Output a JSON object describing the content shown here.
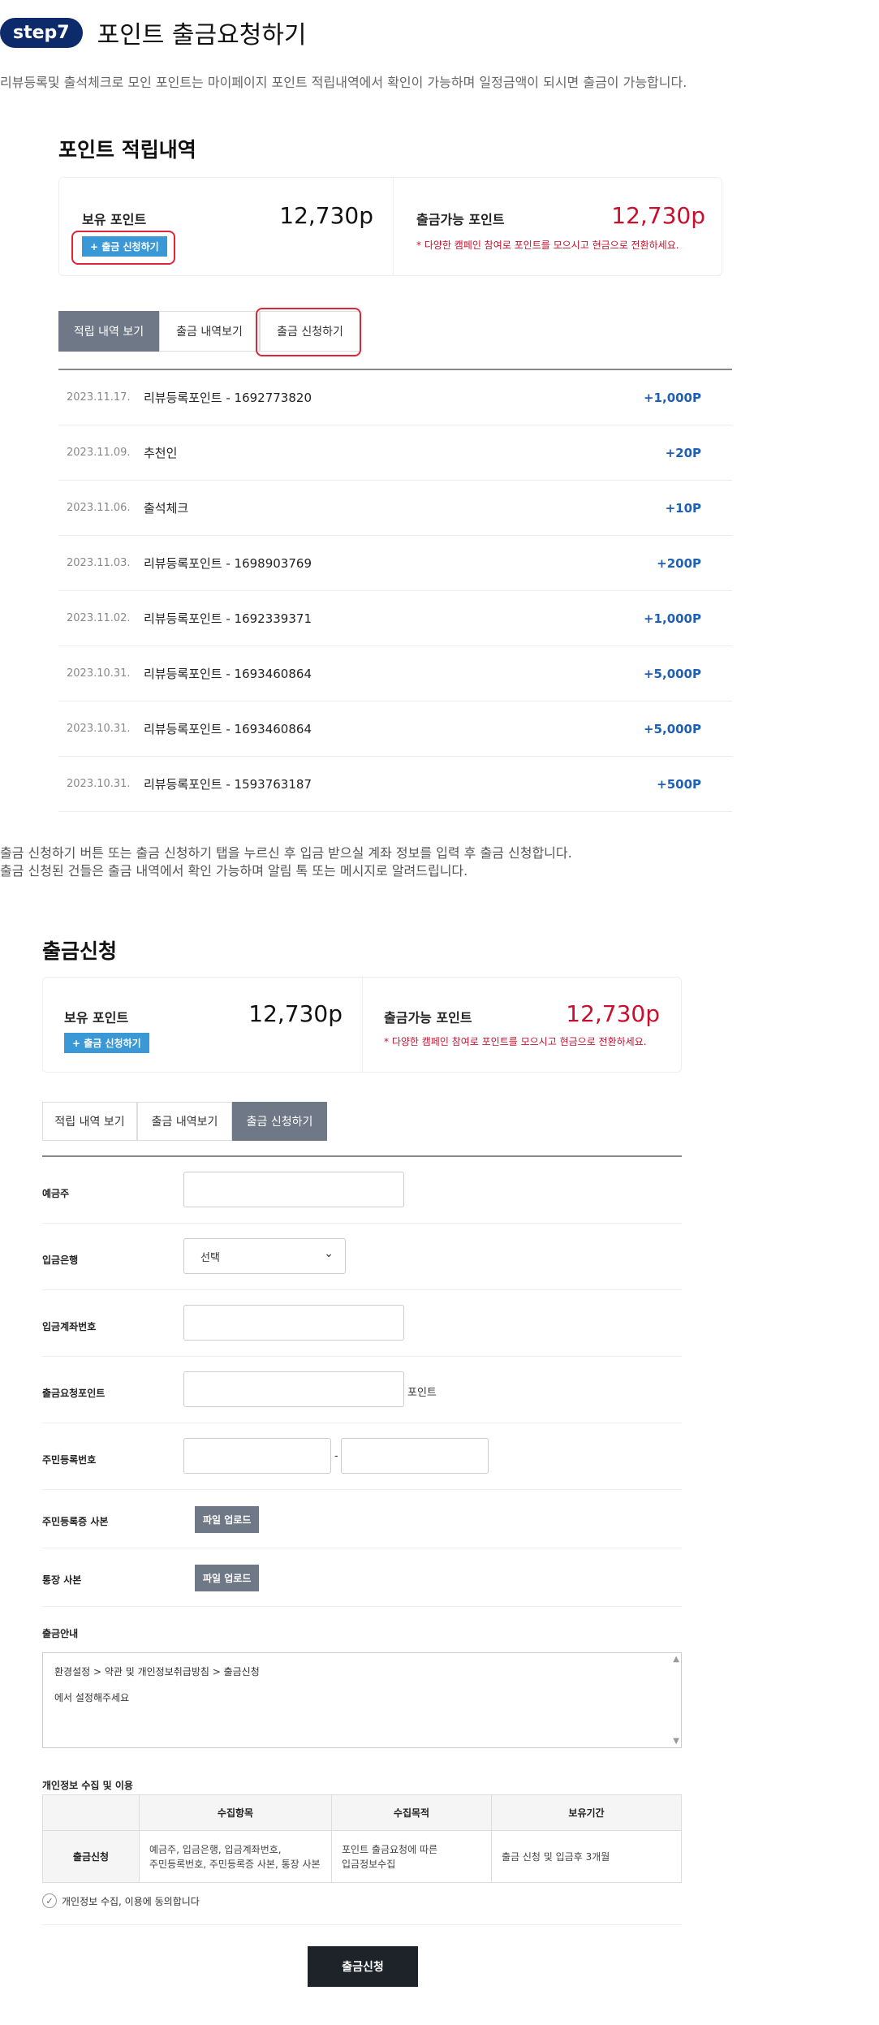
{
  "step": {
    "badge": "step7",
    "title": "포인트 출금요청하기"
  },
  "intro": "리뷰등록및 출석체크로 모인 포인트는 마이페이지 포인트 적립내역에서 확인이 가능하며 일정금액이 되시면 출금이 가능합니다.",
  "history": {
    "title": "포인트 적립내역",
    "card": {
      "held_label": "보유 포인트",
      "held_value": "12,730p",
      "request_button": "+ 출금 신청하기",
      "available_label": "출금가능 포인트",
      "available_value": "12,730p",
      "note": "* 다양한 캠페인 참여로 포인트를 모으시고 현금으로 전환하세요."
    },
    "tabs": [
      {
        "label": "적립 내역 보기"
      },
      {
        "label": "출금 내역보기"
      },
      {
        "label": "출금 신청하기"
      }
    ],
    "rows": [
      {
        "date": "2023.11.17.",
        "desc": "리뷰등록포인트 - 1692773820",
        "amount": "+1,000P"
      },
      {
        "date": "2023.11.09.",
        "desc": "추천인",
        "amount": "+20P"
      },
      {
        "date": "2023.11.06.",
        "desc": "출석체크",
        "amount": "+10P"
      },
      {
        "date": "2023.11.03.",
        "desc": "리뷰등록포인트 - 1698903769",
        "amount": "+200P"
      },
      {
        "date": "2023.11.02.",
        "desc": "리뷰등록포인트 - 1692339371",
        "amount": "+1,000P"
      },
      {
        "date": "2023.10.31.",
        "desc": "리뷰등록포인트 - 1693460864",
        "amount": "+5,000P"
      },
      {
        "date": "2023.10.31.",
        "desc": "리뷰등록포인트 - 1693460864",
        "amount": "+5,000P"
      },
      {
        "date": "2023.10.31.",
        "desc": "리뷰등록포인트 - 1593763187",
        "amount": "+500P"
      }
    ]
  },
  "note2": {
    "line1": "출금 신청하기 버튼 또는 출금 신청하기 탭을 누르신 후 입금 받으실 계좌 정보를 입력 후 출금 신청합니다.",
    "line2": "출금 신청된 건들은 출금 내역에서 확인 가능하며 알림 톡 또는 메시지로 알려드립니다."
  },
  "withdraw": {
    "title": "출금신청",
    "card": {
      "held_label": "보유 포인트",
      "held_value": "12,730p",
      "request_button": "+ 출금 신청하기",
      "available_label": "출금가능 포인트",
      "available_value": "12,730p",
      "note": "* 다양한 캠페인 참여로 포인트를 모으시고 현금으로 전환하세요."
    },
    "tabs": [
      {
        "label": "적립 내역 보기"
      },
      {
        "label": "출금 내역보기"
      },
      {
        "label": "출금 신청하기"
      }
    ],
    "form": {
      "depositor": "예금주",
      "bank": "입금은행",
      "bank_selected": "선택",
      "account": "입금계좌번호",
      "request_points": "출금요청포인트",
      "points_suffix": "포인트",
      "rrn": "주민등록번호",
      "rrn_dash": "-",
      "rrn_copy": "주민등록증 사본",
      "bankbook_copy": "통장 사본",
      "upload_label": "파일 업로드",
      "guide_label": "출금안내",
      "guide_line1": "환경설정 > 약관 및 개인정보취급방침 > 출금신청",
      "guide_line2": "에서 설정해주세요"
    },
    "privacy": {
      "title": "개인정보 수집 및 이용",
      "headers": [
        "수집항목",
        "수집목적",
        "보유기간"
      ],
      "row_head": "출금신청",
      "items1": "예금주, 입금은행, 입금계좌번호,",
      "items2": "주민등록번호, 주민등록증 사본, 통장 사본",
      "purpose1": "포인트 출금요청에 따른",
      "purpose2": "입금정보수집",
      "period": "출금 신청 및 입금후 3개월",
      "agree": "개인정보 수집, 이용에 동의합니다"
    },
    "submit": "출금신청"
  },
  "colors": {
    "badge": "#0d2a6b",
    "accent_red": "#c8102e",
    "amount_blue": "#1e60b8",
    "tab_active": "#6f7886",
    "highlight": "#e0243a"
  }
}
